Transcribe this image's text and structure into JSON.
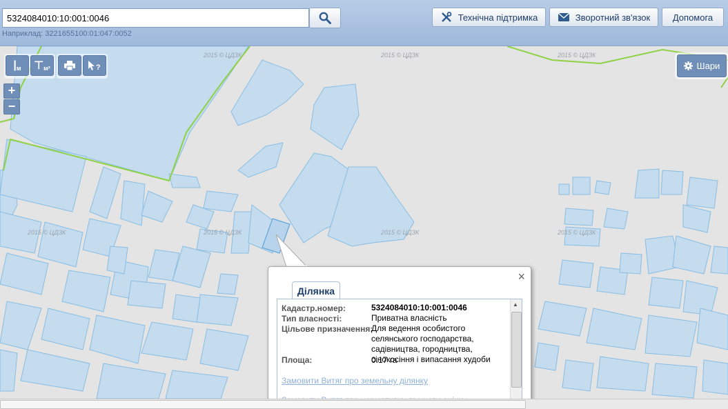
{
  "search": {
    "value": "5324084010:10:001:0046",
    "hint": "Наприклад: 3221655100:01:047:0052",
    "icon": "search-icon"
  },
  "header_buttons": [
    {
      "label": "Технічна підтримка",
      "icon": "tools-icon"
    },
    {
      "label": "Зворотний зв'язок",
      "icon": "envelope-icon"
    },
    {
      "label": "Допомога"
    }
  ],
  "tools": {
    "measure_line": "м",
    "measure_area": "м²",
    "print_icon": "printer-icon",
    "info_icon": "pointer-question-icon"
  },
  "zoom": {
    "in": "+",
    "out": "−"
  },
  "layers_button": {
    "label": "Шари",
    "icon": "gear-icon"
  },
  "watermark": "2015 © ЦДЗК",
  "popup": {
    "tab_label": "Ділянка",
    "fields": {
      "cadastral_label": "Кадастр.номер:",
      "cadastral_value": "5324084010:10:001:0046",
      "ownership_label": "Тип власності:",
      "ownership_value": "Приватна власність",
      "purpose_label": "Цільове призначення:",
      "purpose_value": "Для ведення особистого селянського господарства, садівництва, городництва, сінокосіння і випасання худоби",
      "area_label": "Площа:",
      "area_value": "0.17 га"
    },
    "links": [
      "Замовити Витяг про земельну ділянку",
      "Замовити Витяг про нормативну грошову оцінку"
    ]
  },
  "colors": {
    "parcel_fill": "#c5dcef",
    "parcel_stroke": "#87bde3",
    "boundary": "#8fd144",
    "map_bg": "#e4e4e4",
    "toolbar": "#6f8fb8"
  }
}
